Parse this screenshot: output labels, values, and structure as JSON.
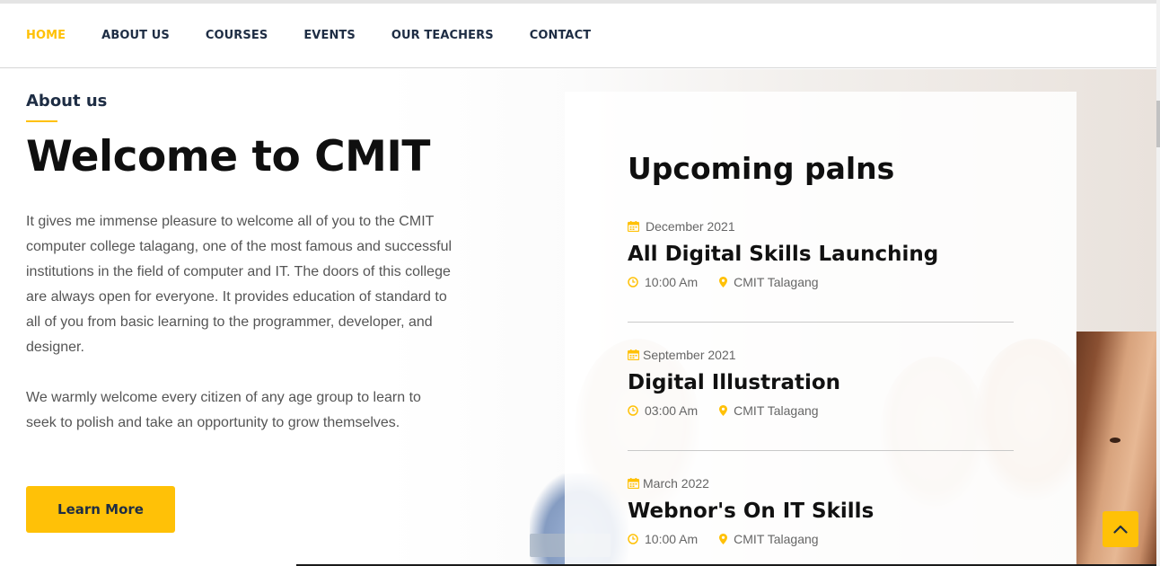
{
  "nav": {
    "items": [
      {
        "label": "HOME",
        "active": true
      },
      {
        "label": "ABOUT US",
        "active": false
      },
      {
        "label": "COURSES",
        "active": false
      },
      {
        "label": "EVENTS",
        "active": false
      },
      {
        "label": "OUR TEACHERS",
        "active": false
      },
      {
        "label": "CONTACT",
        "active": false
      }
    ]
  },
  "about": {
    "label": "About us",
    "title": "Welcome to CMIT",
    "paragraph1": "It gives me immense pleasure to welcome all of you to the CMIT computer college talagang, one of the most famous and successful institutions in the field of computer and IT. The doors of this college are always open for everyone. It provides education of standard to all of you from basic learning to the programmer, developer, and designer.",
    "paragraph2": "We warmly welcome every citizen of any age group to learn to seek to polish and take an opportunity to grow themselves.",
    "button_label": "Learn More"
  },
  "plans": {
    "title": "Upcoming palns",
    "events": [
      {
        "date": "December 2021",
        "name": "All Digital Skills Launching",
        "time": "10:00 Am",
        "location": "CMIT Talagang"
      },
      {
        "date": "September 2021",
        "name": "Digital Illustration",
        "time": "03:00 Am",
        "location": "CMIT Talagang"
      },
      {
        "date": "March 2022",
        "name": "Webnor's On IT Skills",
        "time": "10:00 Am",
        "location": "CMIT Talagang"
      }
    ]
  },
  "icons": {
    "calendar": "calendar-icon",
    "clock": "clock-icon",
    "location": "map-pin-icon",
    "back_to_top": "chevron-up-icon"
  },
  "colors": {
    "accent": "#ffc107",
    "navy": "#1e2d44",
    "heading": "#0f0f0f",
    "body_text": "#555555"
  }
}
